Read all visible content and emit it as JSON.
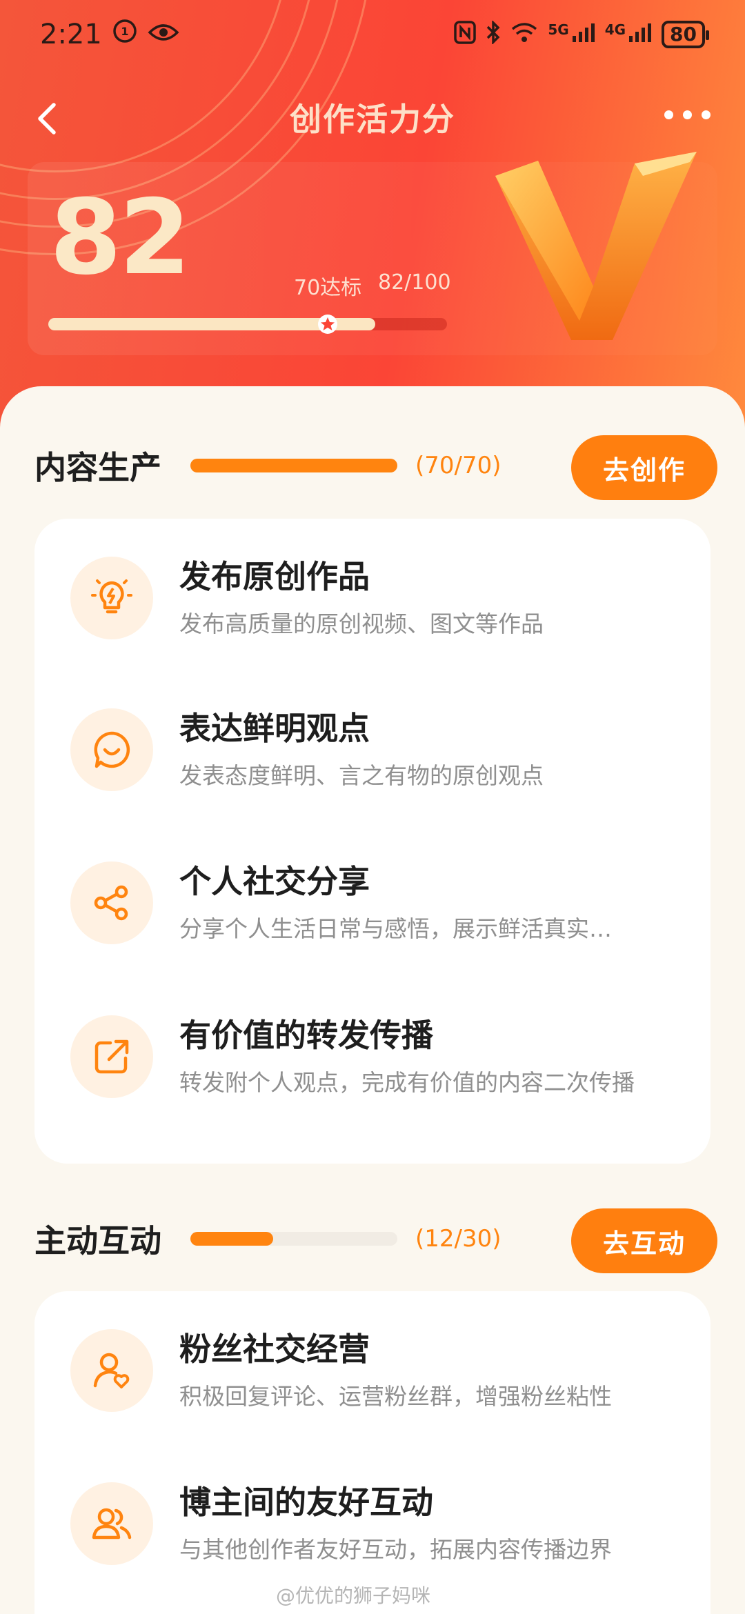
{
  "status_bar": {
    "time": "2:21",
    "network_5g": "5G",
    "network_4g": "4G",
    "battery": "80"
  },
  "nav": {
    "title": "创作活力分"
  },
  "score_panel": {
    "score": "82",
    "target_label": "70达标",
    "ratio_label": "82/100",
    "progress_fraction": 0.82,
    "target_fraction": 0.7
  },
  "sections": [
    {
      "title": "内容生产",
      "count": "(70/70)",
      "progress_fraction": 1.0,
      "button": "去创作",
      "items": [
        {
          "title": "发布原创作品",
          "desc": "发布高质量的原创视频、图文等作品",
          "icon": "lightbulb-icon"
        },
        {
          "title": "表达鲜明观点",
          "desc": "发表态度鲜明、言之有物的原创观点",
          "icon": "smile-chat-icon"
        },
        {
          "title": "个人社交分享",
          "desc": "分享个人生活日常与感悟，展示鲜活真实…",
          "icon": "share-icon"
        },
        {
          "title": "有价值的转发传播",
          "desc": "转发附个人观点，完成有价值的内容二次传播",
          "icon": "forward-icon"
        }
      ]
    },
    {
      "title": "主动互动",
      "count": "(12/30)",
      "progress_fraction": 0.4,
      "button": "去互动",
      "items": [
        {
          "title": "粉丝社交经营",
          "desc": "积极回复评论、运营粉丝群，增强粉丝粘性",
          "icon": "user-heart-icon"
        },
        {
          "title": "博主间的友好互动",
          "desc": "与其他创作者友好互动，拓展内容传播边界",
          "icon": "users-icon"
        }
      ]
    }
  ],
  "watermark": "@优优的狮子妈咪",
  "colors": {
    "accent": "#ff7f0f",
    "header_red": "#fb4536",
    "score_cream": "#fbe8c6"
  }
}
